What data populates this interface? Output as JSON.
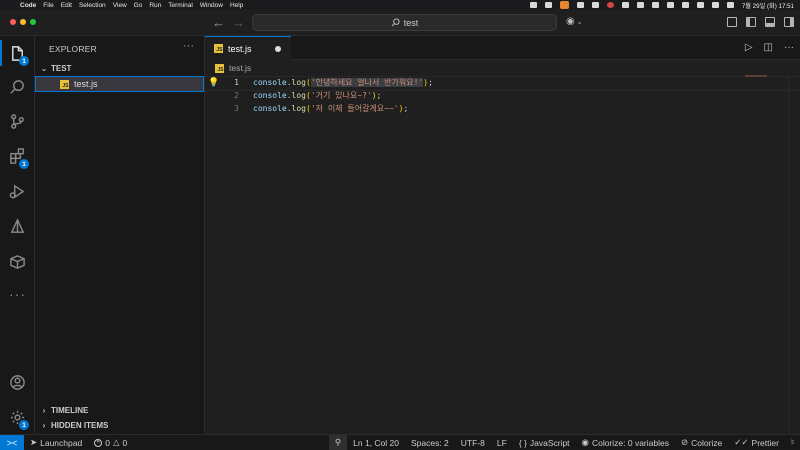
{
  "menubar": {
    "apple": "",
    "items": [
      "Code",
      "File",
      "Edit",
      "Selection",
      "View",
      "Go",
      "Run",
      "Terminal",
      "Window",
      "Help"
    ],
    "clock": "7월 29일 (화) 17:51"
  },
  "titlebar": {
    "back_icon": "arrow-left-icon",
    "forward_icon": "arrow-right-icon",
    "search_text": "test"
  },
  "activity_bar": {
    "explorer_badge": "1",
    "extensions_badge": "1",
    "settings_badge": "1"
  },
  "sidebar": {
    "title": "EXPLORER",
    "more": "···",
    "folder": "TEST",
    "files": [
      {
        "name": "test.js",
        "icon": "JS"
      }
    ],
    "timeline": "TIMELINE",
    "hidden_items": "HIDDEN ITEMS"
  },
  "editor": {
    "tab_label": "test.js",
    "breadcrumb_file": "test.js",
    "line_numbers": [
      "1",
      "2",
      "3"
    ],
    "lines": [
      {
        "ident": "console",
        "dot": ".",
        "fn": "log",
        "open": "(",
        "str": "'안녕하세요 얼나서 반가워요!'",
        "close": ")",
        "semi": ";"
      },
      {
        "ident": "console",
        "dot": ".",
        "fn": "log",
        "open": "(",
        "str": "'거기 있나요~?'",
        "close": ")",
        "semi": ";"
      },
      {
        "ident": "console",
        "dot": ".",
        "fn": "log",
        "open": "(",
        "str": "'저 이제 들어갈게요~~'",
        "close": ")",
        "semi": ";"
      }
    ]
  },
  "statusbar": {
    "remote": "><",
    "launchpad": "Launchpad",
    "errors": "0",
    "warnings": "0",
    "position": "Ln 1, Col 20",
    "spaces": "Spaces: 2",
    "encoding": "UTF-8",
    "eol": "LF",
    "language_braces": "{ }",
    "language": "JavaScript",
    "colorize_vars": "Colorize: 0 variables",
    "colorize": "Colorize",
    "prettier": "Prettier"
  },
  "colors": {
    "accent": "#0078d4",
    "js_icon": "#e8c13c",
    "string": "#ce9178",
    "function": "#dcdcaa",
    "identifier": "#9cdcfe"
  }
}
